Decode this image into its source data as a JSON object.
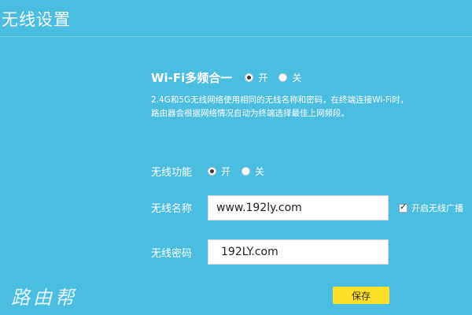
{
  "header": {
    "title": "无线设置"
  },
  "multiband": {
    "label": "Wi-Fi多频合一",
    "options": [
      {
        "label": "开",
        "checked": true
      },
      {
        "label": "关",
        "checked": false
      }
    ],
    "description_line1": "2.4G和5G无线网络使用相同的无线名称和密码，在终端连接Wi-Fi时，",
    "description_line2": "路由器会根据网络情况自动为终端选择最佳上网频段。"
  },
  "wireless_function": {
    "label": "无线功能",
    "options": [
      {
        "label": "开",
        "checked": true
      },
      {
        "label": "关",
        "checked": false
      }
    ]
  },
  "ssid": {
    "label": "无线名称",
    "value": "www.192ly.com",
    "broadcast_label": "开启无线广播",
    "broadcast_checked": true
  },
  "password": {
    "label": "无线密码",
    "value": "192LY.com"
  },
  "save_label": "保存",
  "watermark": "路由帮"
}
